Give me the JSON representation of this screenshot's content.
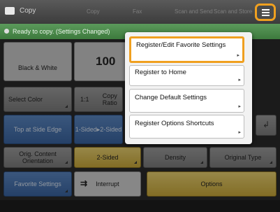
{
  "header": {
    "app_title": "Copy",
    "tabs": [
      "Copy",
      "Fax",
      "Scan and Send",
      "Scan and Store"
    ]
  },
  "status": {
    "text": "Ready to copy. (Settings Changed)"
  },
  "panels": {
    "color_mode": "Black & White",
    "copy_count": "100",
    "select_color": "Select Color",
    "ratio_value": "1:1",
    "copy_ratio": "Copy Ratio",
    "top_at_side_edge": "Top at Side Edge",
    "sided": "1-Sided▸2-Sided",
    "orig_content_orientation": "Orig. Content Orientation",
    "two_sided": "2-Sided",
    "density": "Density",
    "original_type": "Original Type",
    "favorite_settings": "Favorite Settings",
    "interrupt": "Interrupt",
    "options": "Options"
  },
  "menu": {
    "items": [
      {
        "label": "Register/Edit Favorite Settings"
      },
      {
        "label": "Register to Home"
      },
      {
        "label": "Change Default Settings"
      },
      {
        "label": "Register Options Shortcuts"
      }
    ]
  },
  "colors": {
    "accent": "#f0a020",
    "status_green": "#4a8a4a",
    "panel_blue": "#3a64a0",
    "panel_yellow": "#c9a83a"
  },
  "icons": [
    "copy-icon",
    "menu-icon",
    "interrupt-icon",
    "shortcut-icon"
  ]
}
